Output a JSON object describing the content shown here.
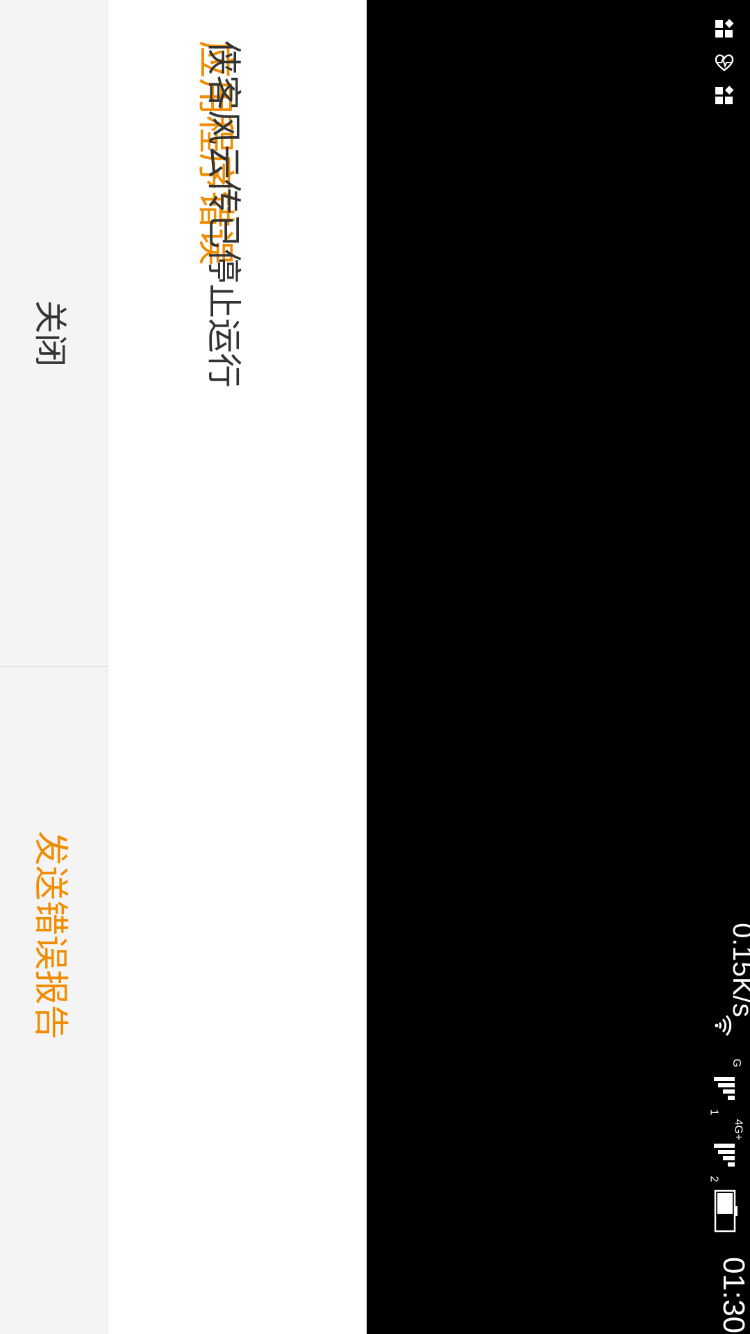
{
  "status_bar": {
    "notification_icons": [
      "app-grid-icon",
      "heart-monitor-icon",
      "app-grid-icon"
    ],
    "net_speed": "0.15K/s",
    "wifi_icon": "wifi-icon",
    "sim1_network_type": "G",
    "sim1_signal_icon": "signal-bars-icon",
    "sim1_slot": "1",
    "sim2_network_type": "4G+",
    "sim2_signal_icon": "signal-bars-icon",
    "sim2_slot": "2",
    "battery_icon": "battery-icon",
    "time": "01:30"
  },
  "dialog": {
    "title": "应用程序错误",
    "message": "侠客风云传已停止运行",
    "close_label": "关闭",
    "report_label": "发送错误报告"
  },
  "colors": {
    "accent": "#f08c00",
    "text": "#333333",
    "dialog_bg": "#ffffff",
    "button_bar_bg": "#f4f4f4",
    "screen_bg": "#000000"
  }
}
